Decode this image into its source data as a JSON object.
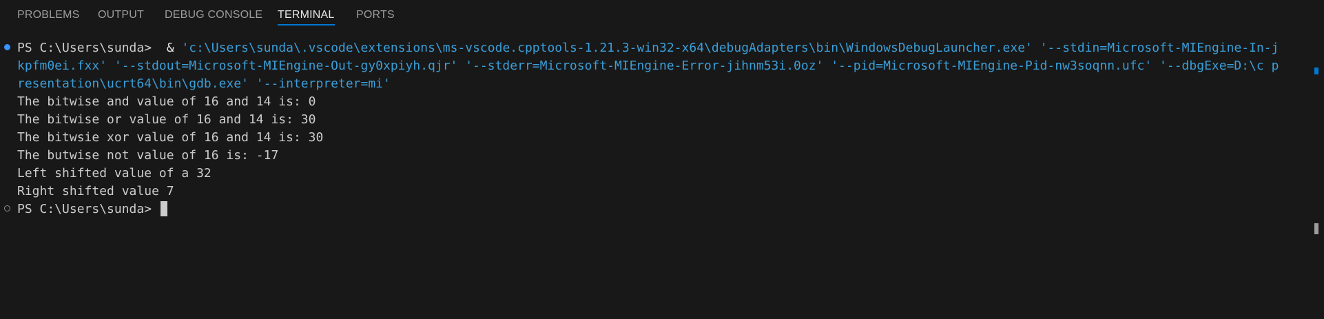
{
  "tabs": [
    {
      "label": "PROBLEMS"
    },
    {
      "label": "OUTPUT"
    },
    {
      "label": "DEBUG CONSOLE"
    },
    {
      "label": "TERMINAL"
    },
    {
      "label": "PORTS"
    }
  ],
  "active_tab": "TERMINAL",
  "terminal": {
    "prompt": "PS C:\\Users\\sunda>",
    "amp": "&",
    "command_lines": [
      "'c:\\Users\\sunda\\.vscode\\extensions\\ms-vscode.cpptools-1.21.3-win32-x64\\debugAdapters\\bin\\WindowsDebugLauncher.exe' '--stdin=Microsoft-MIEngine-In-j",
      "kpfm0ei.fxx' '--stdout=Microsoft-MIEngine-Out-gy0xpiyh.qjr' '--stderr=Microsoft-MIEngine-Error-jihnm53i.0oz' '--pid=Microsoft-MIEngine-Pid-nw3soqnn.ufc' '--dbgExe=D:\\c p",
      "resentation\\ucrt64\\bin\\gdb.exe' '--interpreter=mi'"
    ],
    "output_lines": [
      "The bitwise and value of 16 and 14 is: 0",
      "The bitwise or value of 16 and 14 is: 30",
      "The bitwsie xor value of 16 and 14 is: 30",
      "The butwise not value of 16 is: -17",
      "Left shifted value of a 32",
      "Right shifted value 7"
    ],
    "final_prompt": "PS C:\\Users\\sunda>"
  },
  "colors": {
    "background": "#181818",
    "accent": "#0078d4",
    "command_string": "#3b9ed8",
    "text": "#cccccc"
  }
}
